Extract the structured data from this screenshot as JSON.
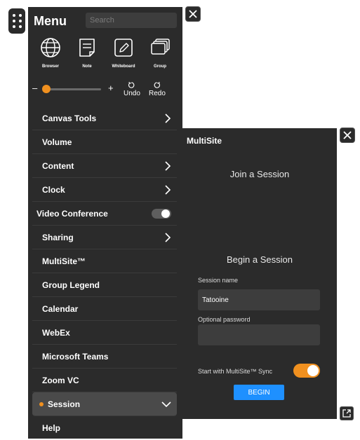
{
  "menu": {
    "title": "Menu",
    "search_placeholder": "Search",
    "tools": [
      {
        "label": "Browser",
        "icon": "globe-icon"
      },
      {
        "label": "Note",
        "icon": "note-icon"
      },
      {
        "label": "Whiteboard",
        "icon": "whiteboard-icon"
      },
      {
        "label": "Group",
        "icon": "group-icon"
      }
    ],
    "zoom": {
      "minus": "–",
      "plus": "+",
      "level": 0.05
    },
    "undo_label": "Undo",
    "redo_label": "Redo",
    "items": [
      {
        "label": "Canvas Tools",
        "chevron": "right"
      },
      {
        "label": "Volume"
      },
      {
        "label": "Content",
        "chevron": "right"
      },
      {
        "label": "Clock",
        "chevron": "right"
      },
      {
        "label": "Video Conference",
        "toggle": false
      },
      {
        "label": "Sharing",
        "chevron": "right"
      },
      {
        "label": "MultiSite™"
      },
      {
        "label": "Group Legend"
      },
      {
        "label": "Calendar"
      },
      {
        "label": "WebEx"
      },
      {
        "label": "Microsoft Teams"
      },
      {
        "label": "Zoom VC"
      },
      {
        "label": "Session",
        "chevron": "down",
        "active": true
      },
      {
        "label": "Help"
      }
    ]
  },
  "multisite": {
    "title": "MultiSite",
    "join_heading": "Join a Session",
    "begin_heading": "Begin a Session",
    "session_name_label": "Session name",
    "session_name_value": "Tatooine",
    "password_label": "Optional password",
    "password_value": "",
    "sync_label": "Start with MultiSite™ Sync",
    "sync_enabled": true,
    "begin_button": "BEGIN"
  },
  "colors": {
    "panel": "#2b2b2b",
    "accent": "#f0901f",
    "button": "#1e90ff"
  }
}
